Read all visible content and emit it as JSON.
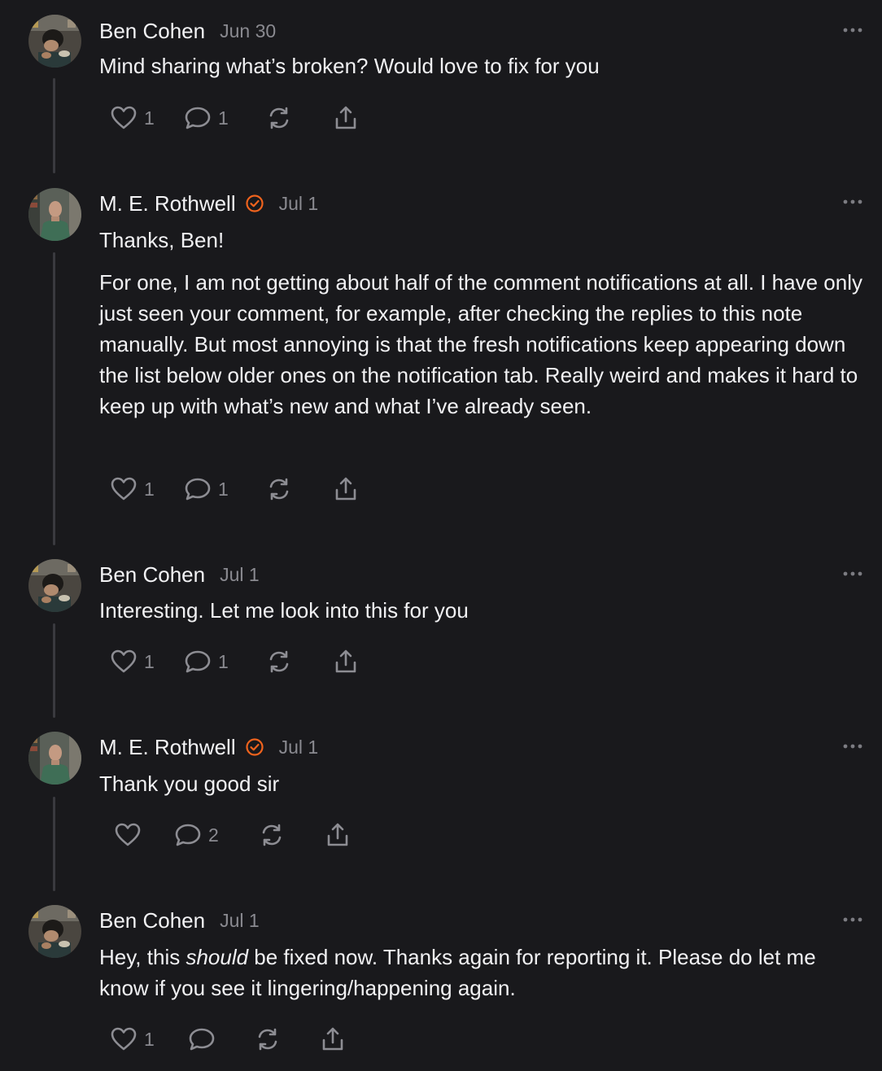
{
  "colors": {
    "background": "#19191c",
    "text": "#f1f1f3",
    "muted": "#8a8a90",
    "verified_badge": "#f0631d",
    "thread_line": "#3a3a3f"
  },
  "comments": [
    {
      "author": "Ben Cohen",
      "verified": false,
      "date": "Jun 30",
      "avatar_icon": "user-avatar-ben",
      "paragraphs": [
        "Mind sharing what’s broken? Would love to fix for you"
      ],
      "likes": "1",
      "replies": "1",
      "restack_icon": "restack-icon",
      "share_icon": "share-icon"
    },
    {
      "author": "M. E. Rothwell",
      "verified": true,
      "date": "Jul 1",
      "avatar_icon": "user-avatar-rothwell",
      "paragraphs": [
        "Thanks, Ben!",
        "For one, I am not getting about half of the comment notifications at all. I have only just seen your comment, for example, after checking the replies to this note manually. But most annoying is that the fresh notifications keep appearing down the list below older ones on the notification tab. Really weird and makes it hard to keep up with what’s new and what I’ve already seen."
      ],
      "likes": "1",
      "replies": "1"
    },
    {
      "author": "Ben Cohen",
      "verified": false,
      "date": "Jul 1",
      "paragraphs": [
        "Interesting. Let me look into this for you"
      ],
      "likes": "1",
      "replies": "1"
    },
    {
      "author": "M. E. Rothwell",
      "verified": true,
      "date": "Jul 1",
      "paragraphs": [
        "Thank you good sir"
      ],
      "likes": "",
      "replies": "2"
    },
    {
      "author": "Ben Cohen",
      "verified": false,
      "date": "Jul 1",
      "paragraphs_rich": {
        "before": "Hey, this ",
        "emphasis": "should",
        "after": " be fixed now. Thanks again for reporting it. Please do let me know if you see it lingering/happening again."
      },
      "likes": "1",
      "replies": ""
    }
  ]
}
